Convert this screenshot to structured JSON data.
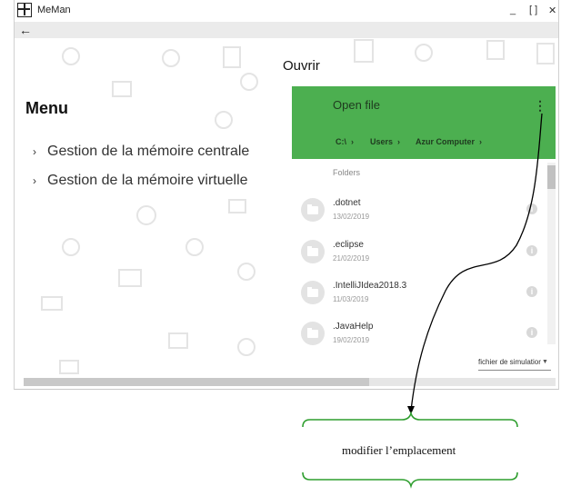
{
  "window": {
    "title": "MeMan",
    "minimize": "_",
    "maximize": "[ ]",
    "close": "✕"
  },
  "toolbar": {
    "back": "←"
  },
  "menu": {
    "title": "Menu",
    "items": [
      {
        "label": "Gestion de la mémoire centrale"
      },
      {
        "label": "Gestion de la mémoire virtuelle"
      }
    ]
  },
  "dialog": {
    "title": "Ouvrir",
    "header": "Open file",
    "breadcrumb": [
      "C:\\",
      "Users",
      "Azur Computer"
    ],
    "folders_label": "Folders",
    "folders": [
      {
        "name": ".dotnet",
        "date": "13/02/2019"
      },
      {
        "name": ".eclipse",
        "date": "21/02/2019"
      },
      {
        "name": ".IntelliJIdea2018.3",
        "date": "11/03/2019"
      },
      {
        "name": ".JavaHelp",
        "date": "19/02/2019"
      }
    ],
    "file_type": "fichier de simulatior"
  },
  "annotation": {
    "label": "modifier l’emplacement"
  },
  "colors": {
    "header": "#4caf50",
    "toolbar": "#ebebeb"
  },
  "icons": [
    "app-icon",
    "back-arrow-icon",
    "kebab-menu-icon",
    "folder-icon",
    "info-icon",
    "chevron-right-icon",
    "dropdown-caret-icon"
  ]
}
